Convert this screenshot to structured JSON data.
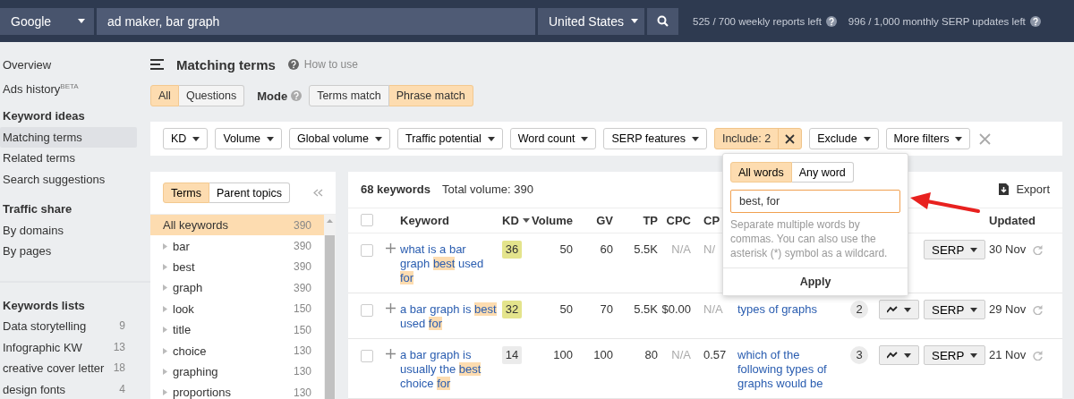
{
  "top_bar": {
    "engine": "Google",
    "query": "ad maker, bar graph",
    "country": "United States",
    "weekly_reports": "525 / 700 weekly reports left",
    "serp_updates": "996 / 1,000 monthly SERP updates left"
  },
  "sidebar": {
    "sections": [
      {
        "items": [
          {
            "label": "Overview",
            "selected": false
          },
          {
            "label": "Ads history$^{BETA}$",
            "selected": false
          }
        ]
      },
      {
        "title": "Keyword ideas",
        "items": [
          {
            "label": "Matching terms",
            "selected": true
          },
          {
            "label": "Related terms",
            "selected": false
          },
          {
            "label": "Search suggestions",
            "selected": false
          }
        ]
      },
      {
        "title": "Traffic share",
        "items": [
          {
            "label": "By domains",
            "selected": false
          },
          {
            "label": "By pages",
            "selected": false
          }
        ]
      }
    ],
    "keywords_lists": {
      "title": "Keywords lists",
      "items": [
        {
          "label": "Data storytelling",
          "count": "9"
        },
        {
          "label": "Infographic KW",
          "count": "13"
        },
        {
          "label": "creative cover letter",
          "count": "18"
        },
        {
          "label": "design fonts",
          "count": "4"
        }
      ]
    }
  },
  "header": {
    "title": "Matching terms",
    "help": "How to use"
  },
  "scope_tabs": [
    {
      "label": "All",
      "selected": true
    },
    {
      "label": "Questions",
      "selected": false
    }
  ],
  "mode": {
    "label": "Mode",
    "options": [
      {
        "label": "Terms match",
        "selected": false
      },
      {
        "label": "Phrase match",
        "selected": true
      }
    ]
  },
  "filters": [
    {
      "label": "KD",
      "active": false
    },
    {
      "label": "Volume",
      "active": false
    },
    {
      "label": "Global volume",
      "active": false
    },
    {
      "label": "Traffic potential",
      "active": false
    },
    {
      "label": "Word count",
      "active": false
    },
    {
      "label": "SERP features",
      "active": false
    },
    {
      "label": "Include: 2",
      "active": true
    },
    {
      "label": "Exclude",
      "active": false
    },
    {
      "label": "More filters",
      "active": false
    }
  ],
  "terms_panel": {
    "tabs": [
      {
        "label": "Terms",
        "selected": true
      },
      {
        "label": "Parent topics",
        "selected": false
      }
    ],
    "items": [
      {
        "label": "All keywords",
        "count": "390",
        "selected": true
      },
      {
        "label": "bar",
        "count": "390",
        "selected": false
      },
      {
        "label": "best",
        "count": "390",
        "selected": false
      },
      {
        "label": "graph",
        "count": "390",
        "selected": false
      },
      {
        "label": "look",
        "count": "150",
        "selected": false
      },
      {
        "label": "title",
        "count": "150",
        "selected": false
      },
      {
        "label": "choice",
        "count": "130",
        "selected": false
      },
      {
        "label": "graphing",
        "count": "130",
        "selected": false
      },
      {
        "label": "proportions",
        "count": "130",
        "selected": false
      }
    ]
  },
  "results": {
    "count": "68 keywords",
    "all_checked": false,
    "total_volume": "Total volume: 390",
    "export": "Export",
    "columns": [
      {
        "label": "Keyword",
        "sorted": false
      },
      {
        "label": "KD",
        "sorted": true
      },
      {
        "label": "Volume",
        "sorted": false
      },
      {
        "label": "GV",
        "sorted": false
      },
      {
        "label": "TP",
        "sorted": false
      },
      {
        "label": "CPC",
        "sorted": false
      },
      {
        "label": "CP"
      },
      {
        "label": "Updated",
        "sorted": false
      }
    ],
    "rows": [
      {
        "checked": false,
        "keyword": [
          {
            "text": "what is a bar graph ",
            "highlight": false
          },
          {
            "text": "best",
            "highlight": true
          },
          {
            "text": " used ",
            "highlight": false
          },
          {
            "text": "for",
            "highlight": true
          }
        ],
        "kd": {
          "value": "36",
          "color": "#e4e48c"
        },
        "volume": "50",
        "gv": "60",
        "tp": "5.5K",
        "cpc": {
          "text": "N/A",
          "muted": true
        },
        "cps": {
          "text": "N/",
          "muted": true
        },
        "serp": "SERP",
        "updated": "30 Nov"
      },
      {
        "checked": false,
        "keyword": [
          {
            "text": "a bar graph is ",
            "highlight": false
          },
          {
            "text": "best",
            "highlight": true
          },
          {
            "text": " used ",
            "highlight": false
          },
          {
            "text": "for",
            "highlight": true
          }
        ],
        "kd": {
          "value": "32",
          "color": "#e4e48c"
        },
        "volume": "50",
        "gv": "70",
        "tp": "5.5K",
        "cpc": {
          "text": "$0.00",
          "muted": false
        },
        "cps": {
          "text": "N/A",
          "muted": true
        },
        "parent_topic": "types of graphs",
        "sf": "2",
        "trend": true,
        "serp": "SERP",
        "updated": "29 Nov"
      },
      {
        "checked": false,
        "keyword": [
          {
            "text": "a bar graph is usually the ",
            "highlight": false
          },
          {
            "text": "best",
            "highlight": true
          },
          {
            "text": " choice ",
            "highlight": false
          },
          {
            "text": "for",
            "highlight": true
          }
        ],
        "kd": {
          "value": "14",
          "color": "#ebebeb"
        },
        "volume": "100",
        "gv": "100",
        "tp": "80",
        "cpc": {
          "text": "N/A",
          "muted": true
        },
        "cps": {
          "text": "0.57",
          "muted": false
        },
        "parent_topic": "which of the following types of graphs would be",
        "sf": "3",
        "trend": true,
        "serp": "SERP",
        "updated": "21 Nov"
      }
    ]
  },
  "include_popover": {
    "tabs": [
      {
        "label": "All words",
        "selected": true
      },
      {
        "label": "Any word",
        "selected": false
      }
    ],
    "value": "best, for",
    "hint": "Separate multiple words by commas. You can also use the asterisk (*) symbol as a wildcard.",
    "apply": "Apply"
  }
}
